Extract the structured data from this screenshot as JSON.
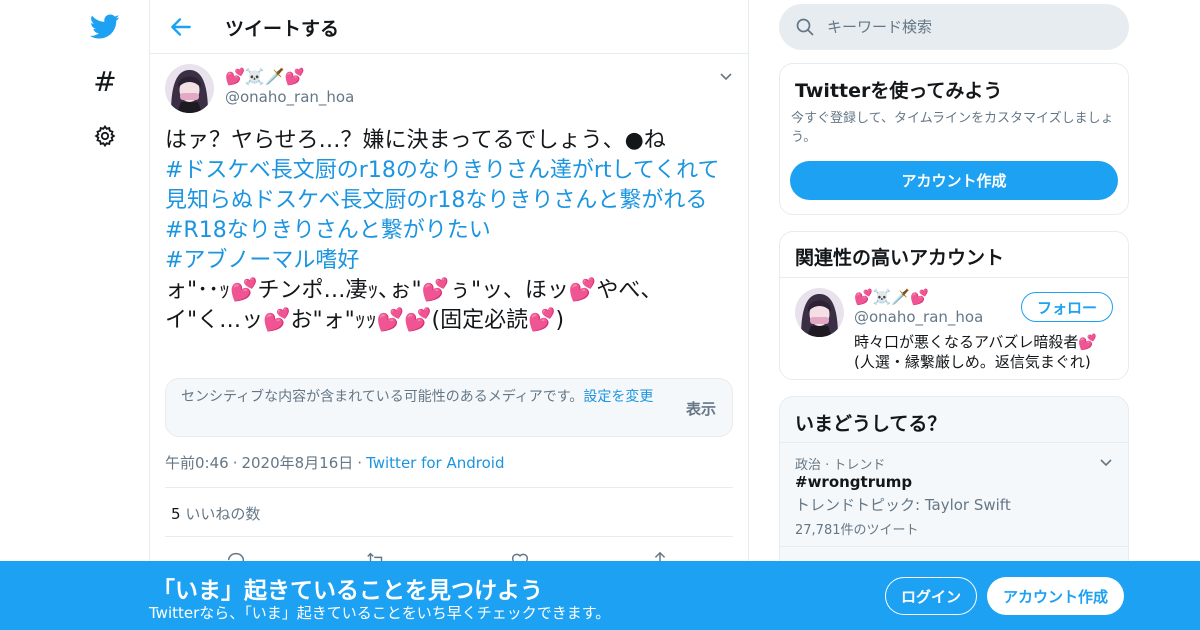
{
  "colors": {
    "accent": "#1da1f2",
    "link": "#1b95e0",
    "muted": "#657786",
    "text": "#14171a",
    "border": "#e6ecf0"
  },
  "nav": {
    "logo_icon": "twitter-bird-icon",
    "explore_glyph": "#",
    "settings_icon": "gear-icon"
  },
  "header": {
    "title": "ツイートする",
    "back_icon": "arrow-left-icon"
  },
  "tweet": {
    "author_name": "💕☠️🗡️💕",
    "author_handle": "@onaho_ran_hoa",
    "text_lines": {
      "l1": "はァ？ヤらせろ…？嫌に決まってるでしょう、●ね",
      "l2": "#ドスケベ長文厨のr18のなりきりさん達がrtしてくれて見知らぬドスケベ長文厨のr18なりきりさんと繋がれる",
      "l3": "#R18なりきりさんと繋がりたい",
      "l4": "#アブノーマル嗜好",
      "l5": "ォ\"･･ｯ💕チンポ…凄ｯ､ぉ\"💕ぅ\"ッ、ほッ💕やべ、",
      "l6": "イ\"く…ッ💕お\"ォ\"ｯｯ💕💕(固定必読💕)"
    },
    "sensitive": {
      "text": "センシティブな内容が含まれている可能性のあるメディアです。",
      "link": "設定を変更",
      "show_label": "表示"
    },
    "meta": {
      "time": "午前0:46",
      "date": "2020年8月16日",
      "via": "Twitter for Android",
      "separator": "·"
    },
    "likes": {
      "count": "5",
      "label": "いいねの数"
    }
  },
  "search": {
    "placeholder": "キーワード検索"
  },
  "signup_card": {
    "title": "Twitterを使ってみよう",
    "description": "今すぐ登録して、タイムラインをカスタマイズしましょう。",
    "button": "アカウント作成"
  },
  "related": {
    "title": "関連性の高いアカウント",
    "account_name": "💕☠️🗡️💕",
    "account_handle": "@onaho_ran_hoa",
    "follow_button": "フォロー",
    "bio": "時々口が悪くなるアバズレ暗殺者💕(人選・縁繋厳しめ。返信気まぐれ)"
  },
  "trends": {
    "title": "いまどうしてる？",
    "item": {
      "category": "政治 · トレンド",
      "name": "#wrongtrump",
      "topic": "トレンドトピック: Taylor Swift",
      "count": "27,781件のツイート"
    }
  },
  "banner": {
    "title": "「いま」起きていることを見つけよう",
    "subtitle": "Twitterなら、「いま」起きていることをいち早くチェックできます。",
    "login": "ログイン",
    "signup": "アカウント作成"
  }
}
